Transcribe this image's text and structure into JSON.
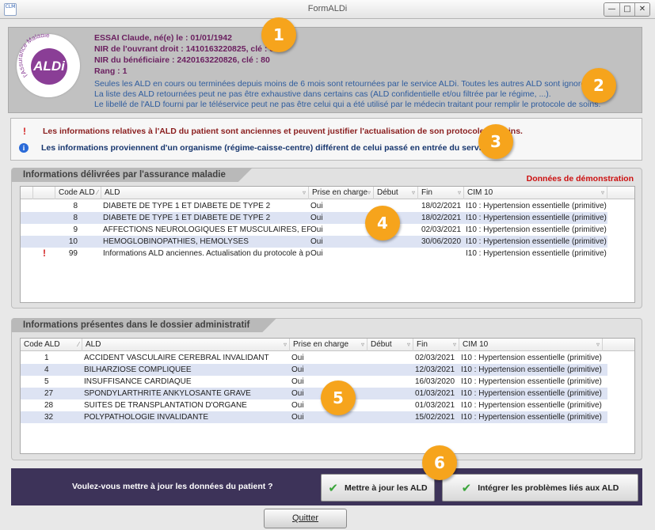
{
  "window": {
    "title": "FormALDi",
    "icon_text": "CLM",
    "buttons": [
      "minimize-icon",
      "maximize-icon",
      "close-icon"
    ]
  },
  "patient": {
    "name_line": "ESSAI Claude, né(e) le : 01/01/1942",
    "nir_ouvrant": "NIR de l'ouvrant droit : 1410163220825, clé : 83",
    "nir_beneficiaire": "NIR du bénéficiaire : 2420163220826, clé : 80",
    "rang": "Rang : 1",
    "logo_arc_text": "l'Assurance Maladie",
    "logo_text": "ALDi"
  },
  "info_lines": [
    "Seules les ALD en cours ou terminées depuis moins de 6 mois sont retournées par le service ALDi. Toutes les autres ALD sont ignorées.",
    "La liste des ALD retournées peut ne pas être exhaustive dans certains cas (ALD confidentielle et/ou filtrée par le régime, ...).",
    "Le libellé de l'ALD fourni par le téléservice peut ne pas être celui qui a été utilisé par le médecin traitant pour remplir le protocole de soins."
  ],
  "warnings": [
    {
      "icon": "exclamation-icon",
      "text": "Les informations relatives à l'ALD du patient sont anciennes et peuvent justifier l'actualisation de son protocole de soins."
    },
    {
      "icon": "info-icon",
      "text": "Les informations proviennent d'un organisme (régime-caisse-centre) différent de celui passé en entrée du service."
    }
  ],
  "insurance_group": {
    "title": "Informations délivrées par l'assurance maladie",
    "demo_label": "Données de démonstration",
    "columns": [
      "Code ALD",
      "ALD",
      "Prise en charge",
      "Début",
      "Fin",
      "CIM 10"
    ],
    "rows": [
      {
        "flag": "",
        "code": "8",
        "ald": "DIABETE DE TYPE 1 ET DIABETE DE TYPE 2",
        "prise": "Oui",
        "debut": "",
        "fin": "18/02/2021",
        "cim": "I10 : Hypertension essentielle (primitive)"
      },
      {
        "flag": "",
        "code": "8",
        "ald": "DIABETE DE TYPE 1 ET DIABETE DE TYPE 2",
        "prise": "Oui",
        "debut": "",
        "fin": "18/02/2021",
        "cim": "I10 : Hypertension essentielle (primitive)"
      },
      {
        "flag": "",
        "code": "9",
        "ald": "AFFECTIONS NEUROLOGIQUES ET MUSCULAIRES, EPILEPSIE",
        "prise": "Oui",
        "debut": "",
        "fin": "02/03/2021",
        "cim": "I10 : Hypertension essentielle (primitive)"
      },
      {
        "flag": "",
        "code": "10",
        "ald": "HEMOGLOBINOPATHIES, HEMOLYSES",
        "prise": "Oui",
        "debut": "",
        "fin": "30/06/2020",
        "cim": "I10 : Hypertension essentielle (primitive)"
      },
      {
        "flag": "!",
        "code": "99",
        "ald": "Informations ALD anciennes. Actualisation du protocole à prévoir.",
        "prise": "Oui",
        "debut": "",
        "fin": "",
        "cim": "I10 : Hypertension essentielle (primitive)"
      }
    ]
  },
  "admin_group": {
    "title": "Informations présentes dans le dossier administratif",
    "columns": [
      "Code ALD",
      "ALD",
      "Prise en charge",
      "Début",
      "Fin",
      "CIM 10"
    ],
    "rows": [
      {
        "code": "1",
        "ald": "ACCIDENT VASCULAIRE CEREBRAL INVALIDANT",
        "prise": "Oui",
        "debut": "",
        "fin": "02/03/2021",
        "cim": "I10 : Hypertension essentielle (primitive)"
      },
      {
        "code": "4",
        "ald": "BILHARZIOSE COMPLIQUEE",
        "prise": "Oui",
        "debut": "",
        "fin": "12/03/2021",
        "cim": "I10 : Hypertension essentielle (primitive)"
      },
      {
        "code": "5",
        "ald": "INSUFFISANCE CARDIAQUE",
        "prise": "Oui",
        "debut": "",
        "fin": "16/03/2020",
        "cim": "I10 : Hypertension essentielle (primitive)"
      },
      {
        "code": "27",
        "ald": "SPONDYLARTHRITE ANKYLOSANTE GRAVE",
        "prise": "Oui",
        "debut": "",
        "fin": "01/03/2021",
        "cim": "I10 : Hypertension essentielle (primitive)"
      },
      {
        "code": "28",
        "ald": "SUITES DE TRANSPLANTATION D'ORGANE",
        "prise": "Oui",
        "debut": "",
        "fin": "01/03/2021",
        "cim": "I10 : Hypertension essentielle (primitive)"
      },
      {
        "code": "32",
        "ald": "POLYPATHOLOGIE INVALIDANTE",
        "prise": "Oui",
        "debut": "",
        "fin": "15/02/2021",
        "cim": "I10 : Hypertension essentielle (primitive)"
      }
    ]
  },
  "actions": {
    "question": "Voulez-vous mettre à jour les données du patient ?",
    "update_label": "Mettre à jour les ALD",
    "integrate_label": "Intégrer les problèmes liés aux ALD",
    "quit_label": "Quitter"
  },
  "callouts": [
    "1",
    "2",
    "3",
    "4",
    "5",
    "6"
  ],
  "colors": {
    "accent_orange": "#f6a41c",
    "bar_purple": "#3d3359",
    "patient_text": "#6b2060",
    "info_text": "#2e5c9e",
    "demo_red": "#cc1010"
  }
}
